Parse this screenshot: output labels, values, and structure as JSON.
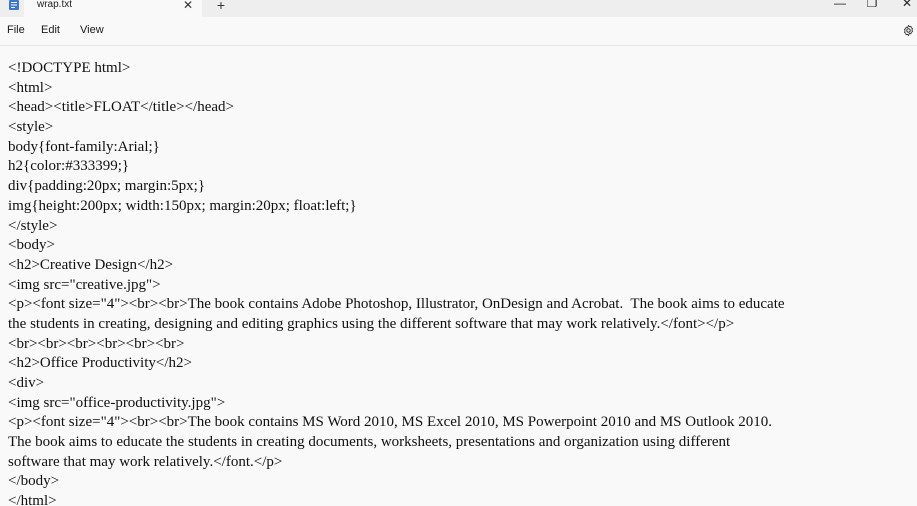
{
  "window": {
    "tab_title": "wrap.txt",
    "tab_close_glyph": "✕",
    "new_tab_glyph": "+",
    "minimize_glyph": "—",
    "maximize_glyph": "❐",
    "close_glyph": "✕"
  },
  "menu": {
    "file": "File",
    "edit": "Edit",
    "view": "View"
  },
  "editor": {
    "lines": [
      "<!DOCTYPE html>",
      "<html>",
      "<head><title>FLOAT</title></head>",
      "<style>",
      "body{font-family:Arial;}",
      "h2{color:#333399;}",
      "div{padding:20px; margin:5px;}",
      "img{height:200px; width:150px; margin:20px; float:left;}",
      "</style>",
      "<body>",
      "<h2>Creative Design</h2>",
      "<img src=\"creative.jpg\">",
      "<p><font size=\"4\"><br><br>The book contains Adobe Photoshop, Illustrator, OnDesign and Acrobat.  The book aims to educate",
      "the students in creating, designing and editing graphics using the different software that may work relatively.</font></p>",
      "<br><br><br><br><br><br>",
      "<h2>Office Productivity</h2>",
      "<div>",
      "<img src=\"office-productivity.jpg\">",
      "<p><font size=\"4\"><br><br>The book contains MS Word 2010, MS Excel 2010, MS Powerpoint 2010 and MS Outlook 2010.",
      "The book aims to educate the students in creating documents, worksheets, presentations and organization using different",
      "software that may work relatively.</font.</p>",
      "</body>",
      "</html>"
    ]
  },
  "icons": {
    "app": "notepad-icon",
    "settings": "gear-icon"
  },
  "colors": {
    "titlebar_bg": "#eeeeee",
    "editor_bg": "#f9f9f9",
    "text": "#111111",
    "app_icon_blue": "#3a78c9"
  }
}
